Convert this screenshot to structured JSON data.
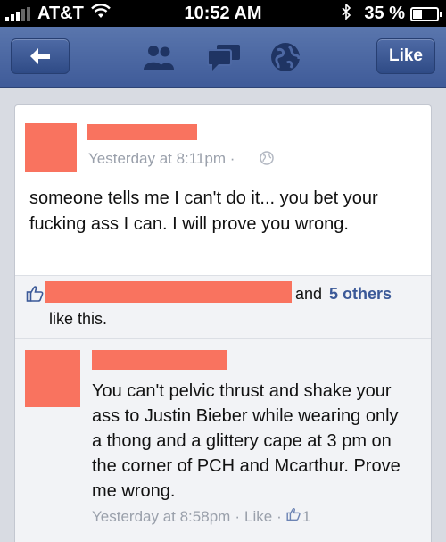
{
  "status_bar": {
    "carrier": "AT&T",
    "time": "10:52 AM",
    "battery": "35 %",
    "battery_level": 0.35
  },
  "nav_bar": {
    "like_label": "Like",
    "icons": [
      "back-arrow-icon",
      "friends-icon",
      "messages-icon",
      "globe-icon"
    ]
  },
  "post": {
    "timestamp": "Yesterday at 8:11pm ·",
    "text": "someone tells me I can't do it... you bet your fucking ass I can. I will prove you wrong.",
    "likes": {
      "and": "and",
      "others": "5 others",
      "suffix": "like this."
    }
  },
  "comment": {
    "text": "You can't pelvic thrust and shake your ass to Justin Bieber while wearing only a thong and a glittery cape at 3 pm on the corner of PCH and Mcarthur. Prove me wrong.",
    "timestamp": "Yesterday at 8:58pm",
    "separator": "·",
    "like_link": "Like",
    "like_count": "1"
  },
  "colors": {
    "nav_blue": "#3f5b99",
    "redaction": "#f9735f",
    "link_blue": "#3b5998",
    "muted_text": "#9aa0ab"
  }
}
